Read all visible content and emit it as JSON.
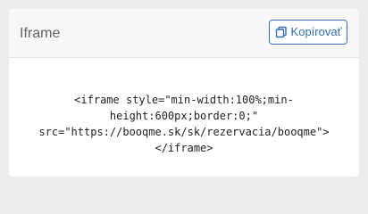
{
  "card": {
    "title": "Iframe",
    "copy_label": "Kopírovať",
    "copy_icon": "copy-icon",
    "code": "<iframe style=\"min-width:100%;min-\nheight:600px;border:0;\"\nsrc=\"https://booqme.sk/sk/rezervacia/booqme\">\n</iframe>"
  }
}
